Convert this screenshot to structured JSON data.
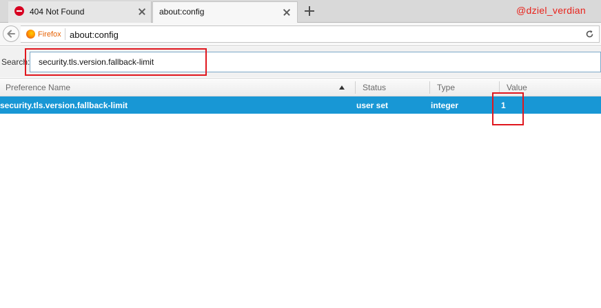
{
  "tabs": [
    {
      "title": "404 Not Found",
      "icon": "error-icon",
      "active": false
    },
    {
      "title": "about:config",
      "active": true
    }
  ],
  "watermark": "@dziel_verdian",
  "navbar": {
    "identity_label": "Firefox",
    "url": "about:config"
  },
  "search": {
    "label": "Search:",
    "value": "security.tls.version.fallback-limit"
  },
  "columns": [
    "Preference Name",
    "Status",
    "Type",
    "Value"
  ],
  "rows": [
    {
      "name": "security.tls.version.fallback-limit",
      "status": "user set",
      "type": "integer",
      "value": "1"
    }
  ],
  "colors": {
    "selected_row": "#1897d5",
    "highlight": "#e0161d",
    "watermark": "#e8221b"
  }
}
